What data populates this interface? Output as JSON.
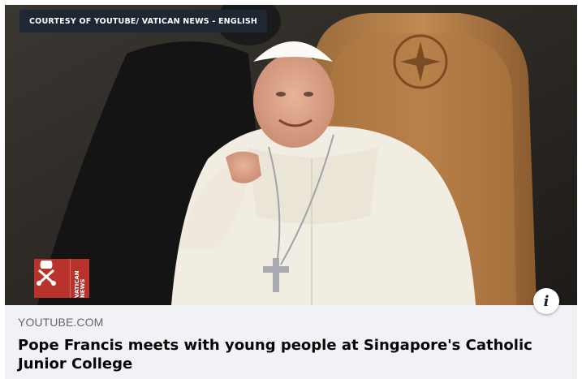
{
  "link_preview": {
    "courtesy_caption": "COURTESY OF YOUTUBE/ VATICAN NEWS - ENGLISH",
    "logo_text": "VATICAN NEWS",
    "domain": "YOUTUBE.COM",
    "title": "Pope Francis meets with young people at Singapore's Catholic Junior College",
    "info_icon": "i",
    "icon_names": [
      "info-icon",
      "vatican-news-logo"
    ]
  },
  "colors": {
    "meta_background": "#f0f2f5",
    "domain_text": "#65676b",
    "title_text": "#050505",
    "caption_background": "#1f2733",
    "logo_red": "#b8332c"
  }
}
